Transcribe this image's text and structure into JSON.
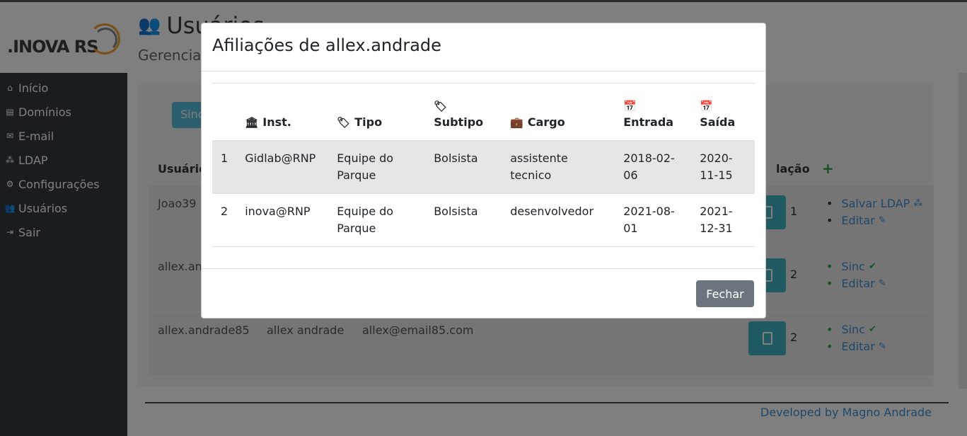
{
  "app": {
    "logo_text": ".INOVA RS"
  },
  "sidebar": {
    "items": [
      {
        "label": "Início",
        "icon": "home-icon"
      },
      {
        "label": "Domínios",
        "icon": "book-icon"
      },
      {
        "label": "E-mail",
        "icon": "envelope-icon"
      },
      {
        "label": "LDAP",
        "icon": "sitemap-icon"
      },
      {
        "label": "Configurações",
        "icon": "gears-icon"
      },
      {
        "label": "Usuários",
        "icon": "users-icon"
      },
      {
        "label": "Sair",
        "icon": "sign-out-icon"
      }
    ]
  },
  "page": {
    "title": "Usuários",
    "subtitle": "Gerencia",
    "sinc_button": "Sinc",
    "table_header_usuario": "Usuário",
    "table_header_afiliacao": "lação",
    "add_symbol": "+",
    "rows": [
      {
        "usuario": "Joao39",
        "nome": "",
        "email": "",
        "afiliacoes": "1",
        "actions": [
          "Salvar LDAP",
          "Editar"
        ]
      },
      {
        "usuario": "allex.an",
        "nome": "",
        "email": "",
        "afiliacoes": "2",
        "actions": [
          "Sinc",
          "Editar"
        ]
      },
      {
        "usuario": "allex.andrade85",
        "nome": "allex andrade",
        "email": "allex@email85.com",
        "afiliacoes": "2",
        "actions": [
          "Sinc",
          "Editar"
        ]
      }
    ],
    "footer": "Developed by Magno Andrade"
  },
  "modal": {
    "title": "Afiliações de allex.andrade",
    "columns": {
      "num": "",
      "inst": "Inst.",
      "tipo": "Tipo",
      "subtipo": "Subtipo",
      "cargo": "Cargo",
      "entrada": "Entrada",
      "saida": "Saída"
    },
    "rows": [
      {
        "num": "1",
        "inst": "Gidlab@RNP",
        "tipo": "Equipe do Parque",
        "subtipo": "Bolsista",
        "cargo": "assistente tecnico",
        "entrada": "2018-02-06",
        "saida": "2020-11-15"
      },
      {
        "num": "2",
        "inst": "inova@RNP",
        "tipo": "Equipe do Parque",
        "subtipo": "Bolsista",
        "cargo": "desenvolvedor",
        "entrada": "2021-08-01",
        "saida": "2021-12-31"
      }
    ],
    "close_label": "Fechar"
  },
  "colors": {
    "sidebar_bg": "#343a40",
    "info_button": "#5bc0de",
    "link": "#3f8fd0",
    "success": "#28a745",
    "secondary_button": "#6c757d"
  }
}
